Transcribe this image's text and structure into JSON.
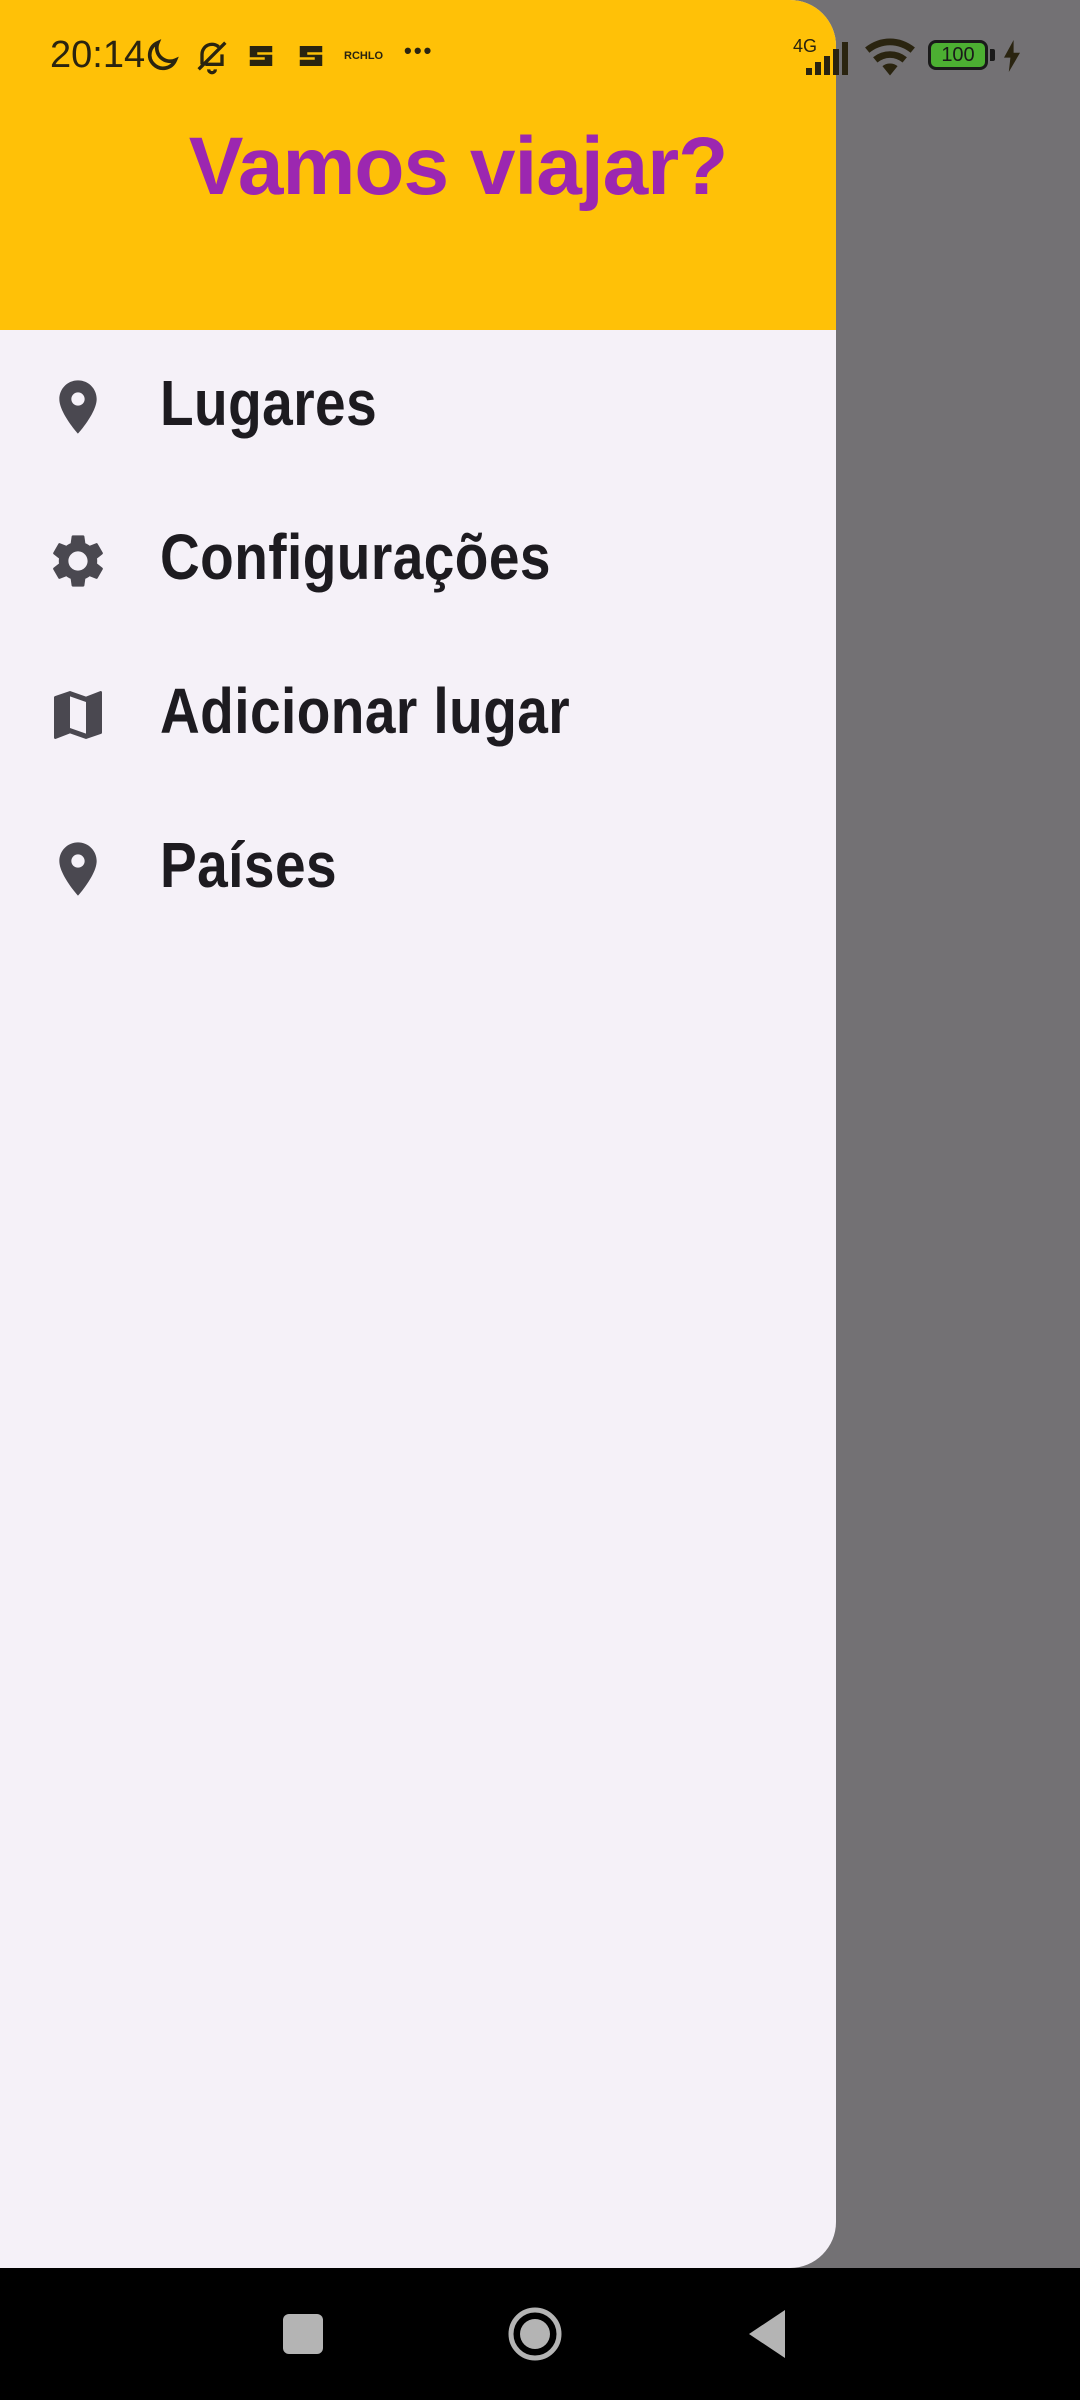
{
  "status_bar": {
    "time": "20:14",
    "network_type": "4G",
    "small_label": "RCHLO",
    "more_dots": "• • •",
    "battery_level": "100"
  },
  "drawer": {
    "title": "Vamos viajar?",
    "items": [
      {
        "label": "Lugares",
        "icon": "location-pin-icon"
      },
      {
        "label": "Configurações",
        "icon": "gear-icon"
      },
      {
        "label": "Adicionar lugar",
        "icon": "map-icon"
      },
      {
        "label": "Países",
        "icon": "location-pin-icon"
      }
    ]
  },
  "colors": {
    "header_bg": "#ffc107",
    "title": "#9c27b0",
    "drawer_bg": "#f5f1f8",
    "scrim": "#737174",
    "icon": "#4a4850",
    "label": "#1d1b20"
  },
  "nav_bar": {
    "buttons": [
      "recents-button",
      "home-button",
      "back-button"
    ]
  }
}
